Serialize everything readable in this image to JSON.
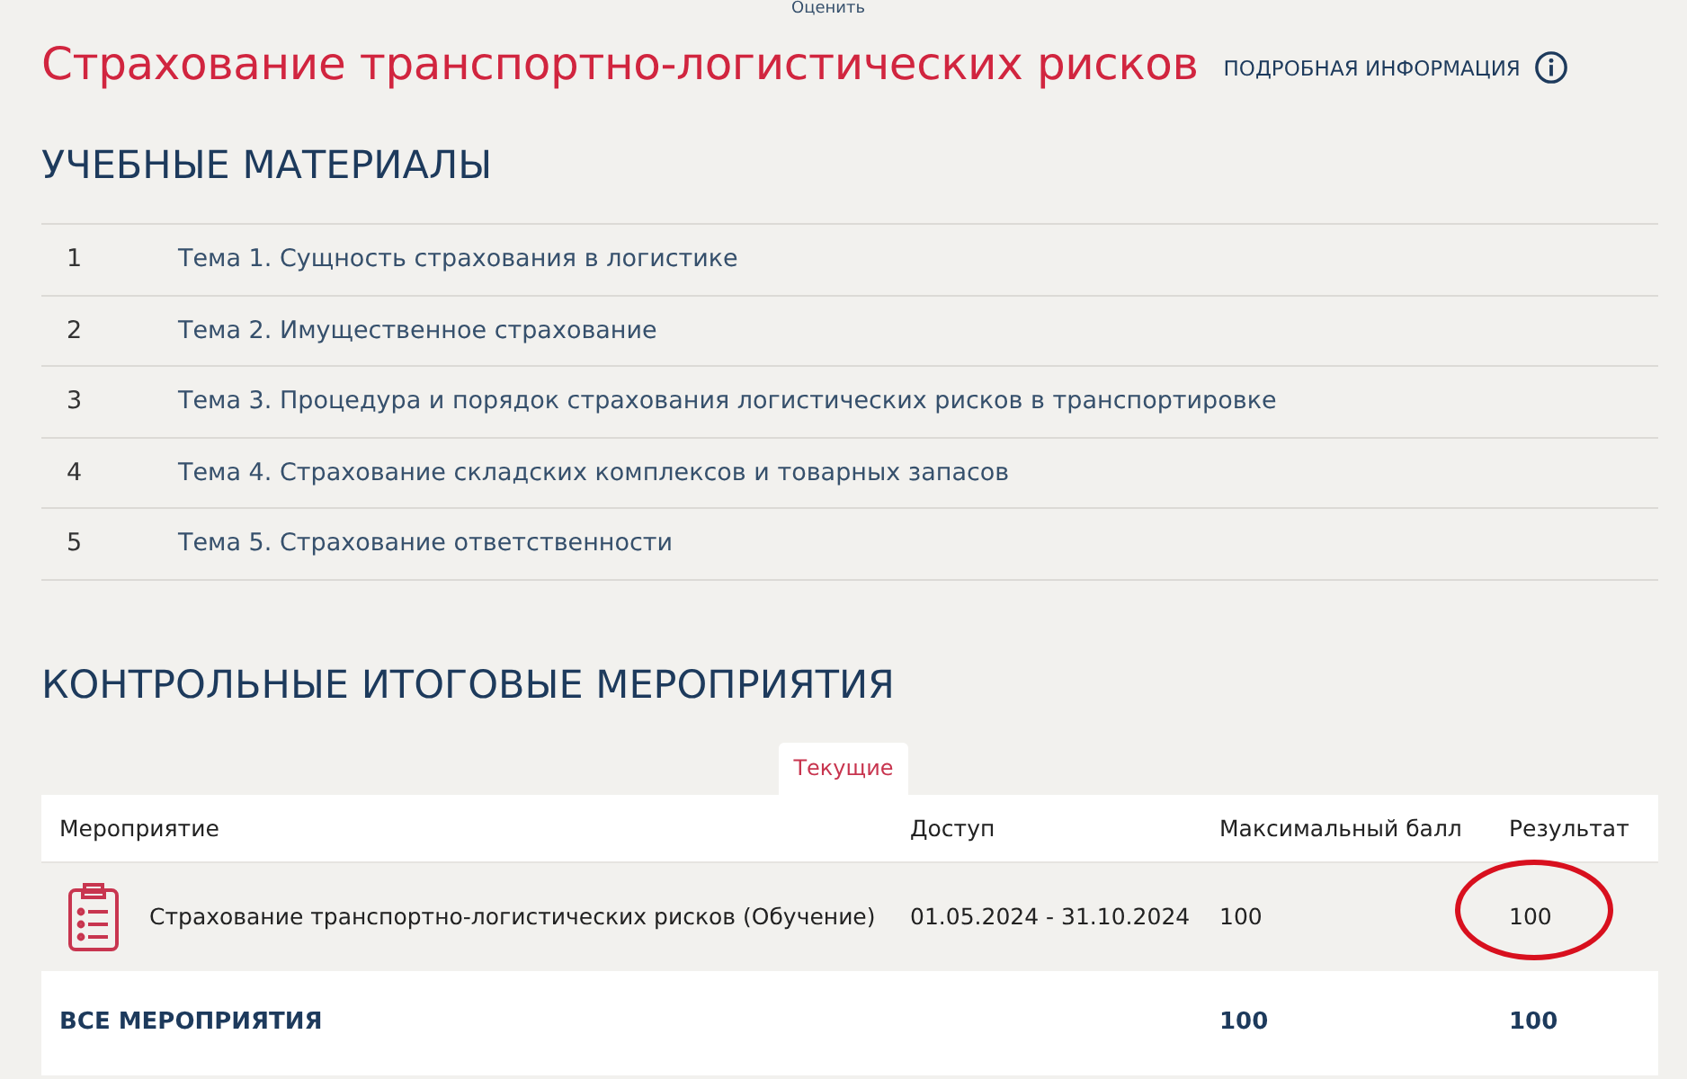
{
  "top_link": "Оценить",
  "course": {
    "title": "Страхование транспортно-логистических рисков",
    "info_link": "ПОДРОБНАЯ ИНФОРМАЦИЯ"
  },
  "materials": {
    "heading": "УЧЕБНЫЕ МАТЕРИАЛЫ",
    "items": [
      {
        "number": "1",
        "title": "Тема 1. Сущность страхования в логистике"
      },
      {
        "number": "2",
        "title": "Тема 2. Имущественное страхование"
      },
      {
        "number": "3",
        "title": "Тема 3. Процедура и порядок страхования логистических рисков в транспортировке"
      },
      {
        "number": "4",
        "title": "Тема 4. Страхование складских комплексов и товарных запасов"
      },
      {
        "number": "5",
        "title": "Тема 5. Страхование ответственности"
      }
    ]
  },
  "events": {
    "heading": "КОНТРОЛЬНЫЕ ИТОГОВЫЕ МЕРОПРИЯТИЯ",
    "tabs": [
      {
        "label": "Текущие",
        "selected": true
      }
    ],
    "table": {
      "columns": [
        "Мероприятие",
        "Доступ",
        "Максимальный балл",
        "Результат"
      ],
      "rows": [
        {
          "name": "Страхование транспортно-логистических рисков (Обучение)",
          "access": "01.05.2024 - 31.10.2024",
          "max_score": "100",
          "result": "100",
          "result_circled": true
        }
      ],
      "total": {
        "label": "ВСЕ МЕРОПРИЯТИЯ",
        "max_score": "100",
        "result": "100"
      }
    }
  }
}
